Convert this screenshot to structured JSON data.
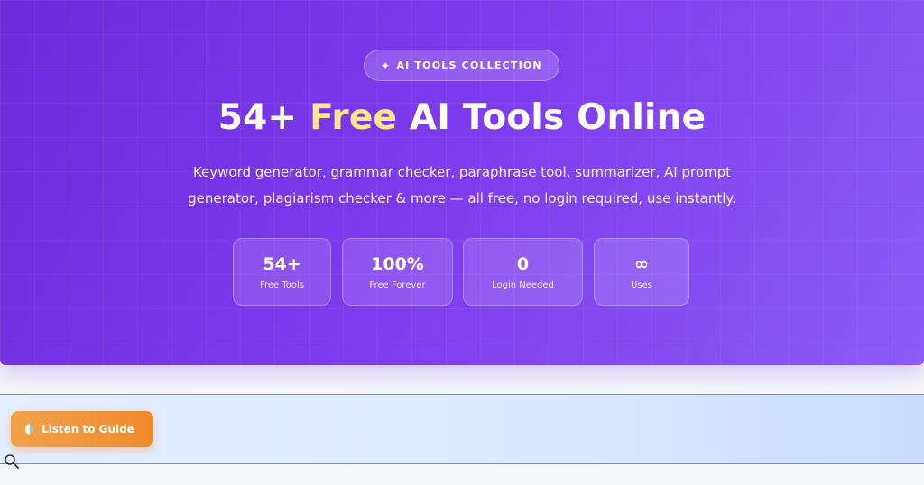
{
  "hero": {
    "badge_icon": "sparkle-icon",
    "badge_text": "AI TOOLS COLLECTION",
    "title_prefix": "54+ ",
    "title_highlight": "Free",
    "title_suffix": " AI Tools Online",
    "subtitle_line1": "Keyword generator, grammar checker, paraphrase tool, summarizer, AI prompt",
    "subtitle_line2": "generator, plagiarism checker & more — all free, no login required, use instantly.",
    "stats": [
      {
        "value": "54+",
        "label": "Free Tools"
      },
      {
        "value": "100%",
        "label": "Free Forever"
      },
      {
        "value": "0",
        "label": "Login Needed"
      },
      {
        "value": "∞",
        "label": "Uses"
      }
    ]
  },
  "guide": {
    "button_label": "Listen to Guide",
    "button_icon": "speaker-icon"
  },
  "search": {
    "icon": "search-icon"
  },
  "colors": {
    "hero_start": "#6a2bdc",
    "hero_end": "#8b5cf6",
    "highlight": "#fde68a",
    "button_orange": "#f08a2c"
  }
}
